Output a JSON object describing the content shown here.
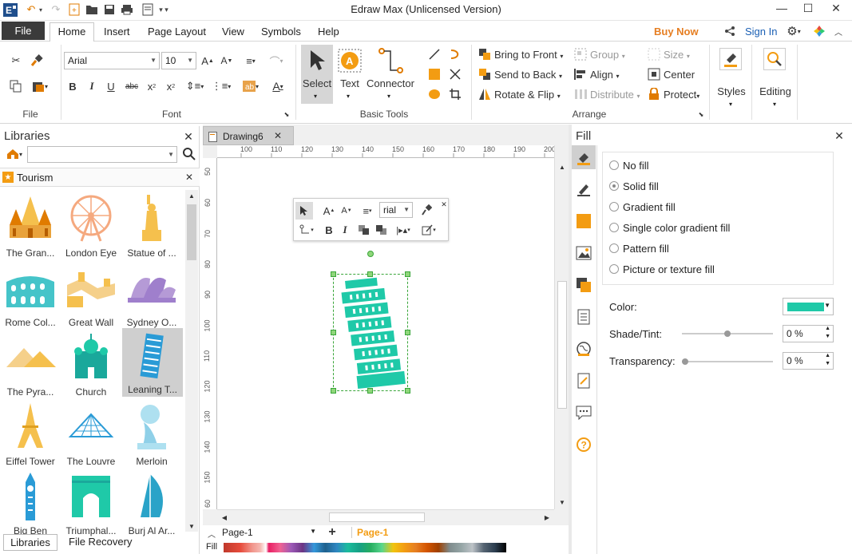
{
  "window": {
    "title": "Edraw Max (Unlicensed Version)"
  },
  "menu": {
    "tabs": [
      {
        "label": "File"
      },
      {
        "label": "Home"
      },
      {
        "label": "Insert"
      },
      {
        "label": "Page Layout"
      },
      {
        "label": "View"
      },
      {
        "label": "Symbols"
      },
      {
        "label": "Help"
      }
    ],
    "buy_now": "Buy Now",
    "sign_in": "Sign In"
  },
  "ribbon": {
    "groups": {
      "file": "File",
      "font": "Font",
      "basic_tools": "Basic Tools",
      "arrange": "Arrange"
    },
    "font_name": "Arial",
    "font_size": "10",
    "tools": {
      "select": "Select",
      "text": "Text",
      "connector": "Connector"
    },
    "arrange": {
      "bring_to_front": "Bring to Front",
      "send_to_back": "Send to Back",
      "rotate_flip": "Rotate & Flip",
      "group": "Group",
      "align": "Align",
      "distribute": "Distribute",
      "size": "Size",
      "center": "Center",
      "protect": "Protect"
    },
    "styles": "Styles",
    "editing": "Editing"
  },
  "libraries": {
    "title": "Libraries",
    "category": "Tourism",
    "items": [
      {
        "label": "The Gran...",
        "icon": "grand-palace-icon"
      },
      {
        "label": "London Eye",
        "icon": "london-eye-icon"
      },
      {
        "label": "Statue of ...",
        "icon": "statue-of-liberty-icon"
      },
      {
        "label": "Rome Col...",
        "icon": "colosseum-icon"
      },
      {
        "label": "Great Wall",
        "icon": "great-wall-icon"
      },
      {
        "label": "Sydney O...",
        "icon": "sydney-opera-icon"
      },
      {
        "label": "The Pyra...",
        "icon": "pyramids-icon"
      },
      {
        "label": "Church",
        "icon": "church-icon"
      },
      {
        "label": "Leaning T...",
        "icon": "leaning-tower-icon"
      },
      {
        "label": "Eiffel Tower",
        "icon": "eiffel-tower-icon"
      },
      {
        "label": "The Louvre",
        "icon": "louvre-icon"
      },
      {
        "label": "Merloin",
        "icon": "merlion-icon"
      },
      {
        "label": "Big Ben",
        "icon": "big-ben-icon"
      },
      {
        "label": "Triumphal...",
        "icon": "triumphal-arch-icon"
      },
      {
        "label": "Burj Al Ar...",
        "icon": "burj-al-arab-icon"
      }
    ],
    "bottom_tabs": [
      {
        "label": "Libraries"
      },
      {
        "label": "File Recovery"
      }
    ]
  },
  "document": {
    "tab": "Drawing6",
    "ruler_h": [
      "100",
      "110",
      "120",
      "130",
      "140",
      "150",
      "160",
      "170",
      "180",
      "190",
      "200"
    ],
    "ruler_v": [
      "50",
      "60",
      "70",
      "80",
      "90",
      "100",
      "110",
      "120",
      "130",
      "140",
      "150",
      "60"
    ],
    "mini_toolbar_font": "rial",
    "page_select": "Page-1",
    "page_tab": "Page-1",
    "fill_label": "Fill"
  },
  "fill_panel": {
    "title": "Fill",
    "options": [
      {
        "label": "No fill",
        "selected": false
      },
      {
        "label": "Solid fill",
        "selected": true
      },
      {
        "label": "Gradient fill",
        "selected": false
      },
      {
        "label": "Single color gradient fill",
        "selected": false
      },
      {
        "label": "Pattern fill",
        "selected": false
      },
      {
        "label": "Picture or texture fill",
        "selected": false
      }
    ],
    "color_label": "Color:",
    "color_value": "#1fc9a8",
    "shade_label": "Shade/Tint:",
    "shade_value": "0 %",
    "transparency_label": "Transparency:",
    "transparency_value": "0 %"
  },
  "colors": {
    "accent": "#f39c12",
    "teal": "#1fc9a8",
    "buy_now": "#e67e22",
    "sign_in": "#1a5fb4"
  }
}
